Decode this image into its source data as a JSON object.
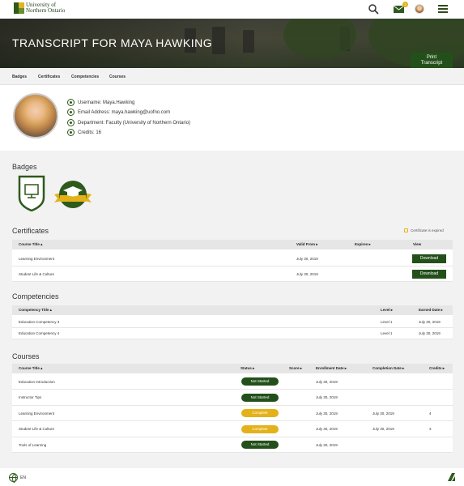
{
  "header": {
    "logo_line1": "University of",
    "logo_line2": "Northern Ontario",
    "mail_count": "2"
  },
  "hero": {
    "title": "TRANSCRIPT FOR MAYA HAWKING",
    "print_line1": "Print",
    "print_line2": "Transcript"
  },
  "tabs": [
    "Badges",
    "Certificates",
    "Competencies",
    "Courses"
  ],
  "profile": {
    "username": "Username: Maya.Hawking",
    "email": "Email Address: maya.hawking@uofno.com",
    "department": "Department: Faculty (University of Northern Ontario)",
    "credits": "Credits: 16"
  },
  "badges": {
    "title": "Badges"
  },
  "certificates": {
    "title": "Certificates",
    "legend": "Certificate is expired",
    "headers": {
      "course": "Course Title ▴",
      "valid": "Valid From ▸",
      "expires": "Expires ▸",
      "view": "View"
    },
    "rows": [
      {
        "course": "Learning Environment",
        "valid": "July 30, 2019",
        "expires": "",
        "action": "Download"
      },
      {
        "course": "Student Life & Culture",
        "valid": "July 30, 2019",
        "expires": "",
        "action": "Download"
      }
    ]
  },
  "competencies": {
    "title": "Competencies",
    "headers": {
      "title": "Competency Title ▴",
      "level": "Level ▸",
      "earned": "Earned Date ▸"
    },
    "rows": [
      {
        "title": "Education Competency 3",
        "level": "Level 1",
        "earned": "July 30, 2019"
      },
      {
        "title": "Education Competency 4",
        "level": "Level 1",
        "earned": "July 30, 2019"
      }
    ]
  },
  "courses": {
    "title": "Courses",
    "headers": {
      "course": "Course Title ▴",
      "status": "Status ▸",
      "score": "Score ▸",
      "enroll": "Enrollment Date ▸",
      "complete": "Completion Date ▸",
      "credits": "Credits ▸"
    },
    "rows": [
      {
        "course": "Education Introduction",
        "status": "Not Started",
        "score": "",
        "enroll": "July 30, 2019",
        "complete": "",
        "credits": ""
      },
      {
        "course": "Instructor Tips",
        "status": "Not Started",
        "score": "",
        "enroll": "July 30, 2019",
        "complete": "",
        "credits": ""
      },
      {
        "course": "Learning Environment",
        "status": "Complete",
        "score": "",
        "enroll": "July 30, 2019",
        "complete": "July 30, 2019",
        "credits": "4"
      },
      {
        "course": "Student Life & Culture",
        "status": "Complete",
        "score": "",
        "enroll": "July 30, 2019",
        "complete": "July 30, 2019",
        "credits": "3"
      },
      {
        "course": "Tools of Learning",
        "status": "Not Started",
        "score": "",
        "enroll": "July 30, 2019",
        "complete": "",
        "credits": ""
      }
    ]
  },
  "footer": {
    "language": "EN"
  },
  "colors": {
    "brand_green": "#23501a",
    "accent_gold": "#e3b21a"
  }
}
